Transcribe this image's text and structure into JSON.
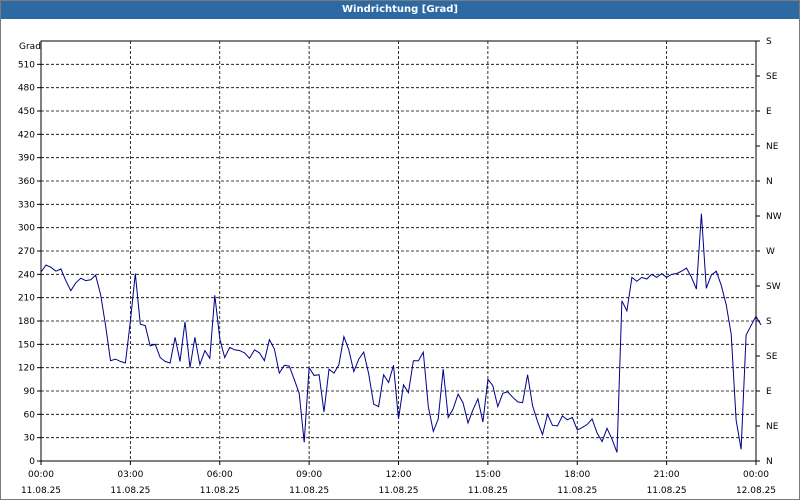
{
  "window": {
    "title": "Windrichtung [Grad]"
  },
  "chart_data": {
    "type": "line",
    "title": "Windrichtung [Grad]",
    "ylabel": "Grad",
    "ylim": [
      0,
      540
    ],
    "xlim": [
      "11.08.25 00:00",
      "12.08.25 00:00"
    ],
    "grid": true,
    "y_ticks": [
      "0",
      "30",
      "60",
      "90",
      "120",
      "150",
      "180",
      "210",
      "240",
      "270",
      "300",
      "330",
      "360",
      "390",
      "420",
      "450",
      "480",
      "510"
    ],
    "y_right_ticks": [
      {
        "value": 0,
        "label": "N"
      },
      {
        "value": 45,
        "label": "NE"
      },
      {
        "value": 90,
        "label": "E"
      },
      {
        "value": 135,
        "label": "SE"
      },
      {
        "value": 180,
        "label": "S"
      },
      {
        "value": 225,
        "label": "SW"
      },
      {
        "value": 270,
        "label": "W"
      },
      {
        "value": 315,
        "label": "NW"
      },
      {
        "value": 360,
        "label": "N"
      },
      {
        "value": 405,
        "label": "NE"
      },
      {
        "value": 450,
        "label": "E"
      },
      {
        "value": 495,
        "label": "SE"
      },
      {
        "value": 540,
        "label": "S"
      }
    ],
    "x_ticks": [
      {
        "time": "00:00",
        "date": "11.08.25"
      },
      {
        "time": "03:00",
        "date": "11.08.25"
      },
      {
        "time": "06:00",
        "date": "11.08.25"
      },
      {
        "time": "09:00",
        "date": "11.08.25"
      },
      {
        "time": "12:00",
        "date": "11.08.25"
      },
      {
        "time": "15:00",
        "date": "11.08.25"
      },
      {
        "time": "18:00",
        "date": "11.08.25"
      },
      {
        "time": "21:00",
        "date": "11.08.25"
      },
      {
        "time": "00:00",
        "date": "12.08.25"
      }
    ],
    "series": [
      {
        "color": "#00008b",
        "points": [
          [
            "00:00",
            243
          ],
          [
            "00:10",
            252
          ],
          [
            "00:20",
            249
          ],
          [
            "00:30",
            244
          ],
          [
            "00:40",
            247
          ],
          [
            "00:50",
            232
          ],
          [
            "01:00",
            219
          ],
          [
            "01:10",
            229
          ],
          [
            "01:20",
            235
          ],
          [
            "01:30",
            232
          ],
          [
            "01:40",
            233
          ],
          [
            "01:50",
            239
          ],
          [
            "02:00",
            214
          ],
          [
            "02:10",
            175
          ],
          [
            "02:20",
            129
          ],
          [
            "02:30",
            131
          ],
          [
            "02:40",
            128
          ],
          [
            "02:50",
            126
          ],
          [
            "03:00",
            180
          ],
          [
            "03:10",
            241
          ],
          [
            "03:20",
            176
          ],
          [
            "03:30",
            174
          ],
          [
            "03:40",
            148
          ],
          [
            "03:50",
            150
          ],
          [
            "04:00",
            133
          ],
          [
            "04:10",
            128
          ],
          [
            "04:20",
            126
          ],
          [
            "04:30",
            159
          ],
          [
            "04:40",
            128
          ],
          [
            "04:50",
            179
          ],
          [
            "05:00",
            120
          ],
          [
            "05:10",
            159
          ],
          [
            "05:20",
            124
          ],
          [
            "05:30",
            142
          ],
          [
            "05:40",
            132
          ],
          [
            "05:50",
            213
          ],
          [
            "06:00",
            157
          ],
          [
            "06:10",
            133
          ],
          [
            "06:20",
            146
          ],
          [
            "06:30",
            143
          ],
          [
            "06:40",
            142
          ],
          [
            "06:50",
            139
          ],
          [
            "07:00",
            132
          ],
          [
            "07:10",
            143
          ],
          [
            "07:20",
            139
          ],
          [
            "07:30",
            129
          ],
          [
            "07:40",
            156
          ],
          [
            "07:50",
            144
          ],
          [
            "08:00",
            113
          ],
          [
            "08:10",
            123
          ],
          [
            "08:20",
            122
          ],
          [
            "08:30",
            105
          ],
          [
            "08:40",
            87
          ],
          [
            "08:50",
            24
          ],
          [
            "09:00",
            120
          ],
          [
            "09:10",
            110
          ],
          [
            "09:20",
            111
          ],
          [
            "09:30",
            63
          ],
          [
            "09:40",
            118
          ],
          [
            "09:50",
            113
          ],
          [
            "10:00",
            124
          ],
          [
            "10:10",
            160
          ],
          [
            "10:20",
            143
          ],
          [
            "10:30",
            115
          ],
          [
            "10:40",
            131
          ],
          [
            "10:50",
            140
          ],
          [
            "11:00",
            112
          ],
          [
            "11:10",
            73
          ],
          [
            "11:20",
            70
          ],
          [
            "11:30",
            111
          ],
          [
            "11:40",
            101
          ],
          [
            "11:50",
            123
          ],
          [
            "12:00",
            54
          ],
          [
            "12:10",
            98
          ],
          [
            "12:20",
            88
          ],
          [
            "12:30",
            129
          ],
          [
            "12:40",
            129
          ],
          [
            "12:50",
            140
          ],
          [
            "13:00",
            70
          ],
          [
            "13:10",
            38
          ],
          [
            "13:20",
            54
          ],
          [
            "13:30",
            118
          ],
          [
            "13:40",
            56
          ],
          [
            "13:50",
            67
          ],
          [
            "14:00",
            86
          ],
          [
            "14:10",
            75
          ],
          [
            "14:20",
            49
          ],
          [
            "14:30",
            66
          ],
          [
            "14:40",
            80
          ],
          [
            "14:50",
            50
          ],
          [
            "15:00",
            105
          ],
          [
            "15:10",
            97
          ],
          [
            "15:20",
            70
          ],
          [
            "15:30",
            87
          ],
          [
            "15:40",
            89
          ],
          [
            "15:50",
            82
          ],
          [
            "16:00",
            76
          ],
          [
            "16:10",
            75
          ],
          [
            "16:20",
            111
          ],
          [
            "16:30",
            71
          ],
          [
            "16:40",
            51
          ],
          [
            "16:50",
            34
          ],
          [
            "17:00",
            60
          ],
          [
            "17:10",
            46
          ],
          [
            "17:20",
            45
          ],
          [
            "17:30",
            58
          ],
          [
            "17:40",
            53
          ],
          [
            "17:50",
            56
          ],
          [
            "18:00",
            40
          ],
          [
            "18:10",
            43
          ],
          [
            "18:20",
            47
          ],
          [
            "18:30",
            54
          ],
          [
            "18:40",
            36
          ],
          [
            "18:50",
            25
          ],
          [
            "19:00",
            42
          ],
          [
            "19:10",
            28
          ],
          [
            "19:20",
            11
          ],
          [
            "19:30",
            206
          ],
          [
            "19:40",
            193
          ],
          [
            "19:50",
            236
          ],
          [
            "20:00",
            231
          ],
          [
            "20:10",
            236
          ],
          [
            "20:20",
            234
          ],
          [
            "20:30",
            240
          ],
          [
            "20:40",
            236
          ],
          [
            "20:50",
            241
          ],
          [
            "21:00",
            236
          ],
          [
            "21:10",
            240
          ],
          [
            "21:20",
            241
          ],
          [
            "21:30",
            244
          ],
          [
            "21:40",
            248
          ],
          [
            "21:50",
            236
          ],
          [
            "22:00",
            221
          ],
          [
            "22:10",
            318
          ],
          [
            "22:20",
            222
          ],
          [
            "22:30",
            239
          ],
          [
            "22:40",
            244
          ],
          [
            "22:50",
            226
          ],
          [
            "23:00",
            201
          ],
          [
            "23:10",
            163
          ],
          [
            "23:20",
            53
          ],
          [
            "23:30",
            15
          ],
          [
            "23:40",
            162
          ],
          [
            "23:50",
            174
          ],
          [
            "24:00",
            186
          ],
          [
            "24:10",
            175
          ]
        ]
      }
    ]
  }
}
